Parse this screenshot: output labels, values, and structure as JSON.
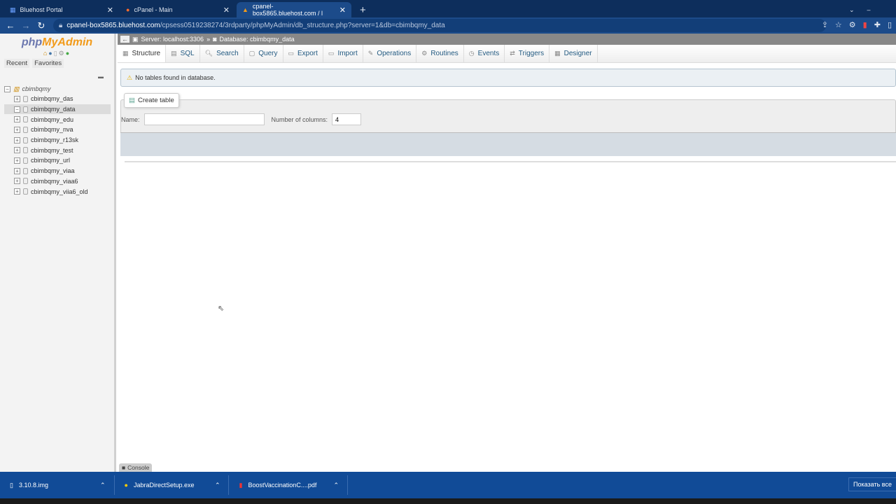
{
  "browser": {
    "tabs": [
      {
        "label": "Bluehost Portal",
        "icon": "grid-icon"
      },
      {
        "label": "cPanel - Main",
        "icon": "cpanel-icon"
      },
      {
        "label": "cpanel-box5865.bluehost.com / l",
        "icon": "phpmyadmin-icon",
        "active": true
      }
    ],
    "url_host": "cpanel-box5865.bluehost.com",
    "url_path": "/cpsess0519238274/3rdparty/phpMyAdmin/db_structure.php?server=1&db=cbimbqmy_data"
  },
  "sidebar": {
    "logo_php": "php",
    "logo_myadmin": "MyAdmin",
    "recent": "Recent",
    "favorites": "Favorites",
    "root": "cbimbqmy",
    "databases": [
      "cbimbqmy_das",
      "cbimbqmy_data",
      "cbimbqmy_edu",
      "cbimbqmy_nva",
      "cbimbqmy_r13sk",
      "cbimbqmy_test",
      "cbimbqmy_url",
      "cbimbqmy_viaa",
      "cbimbqmy_viaa6",
      "cbimbqmy_viia6_old"
    ],
    "selected": "cbimbqmy_data"
  },
  "breadcrumb": {
    "server": "Server: localhost:3306",
    "sep": "»",
    "database": "Database: cbimbqmy_data"
  },
  "menu": [
    "Structure",
    "SQL",
    "Search",
    "Query",
    "Export",
    "Import",
    "Operations",
    "Routines",
    "Events",
    "Triggers",
    "Designer"
  ],
  "notice": "No tables found in database.",
  "create": {
    "legend": "Create table",
    "name_label": "Name:",
    "name_value": "",
    "cols_label": "Number of columns:",
    "cols_value": "4"
  },
  "console": "Console",
  "downloads": [
    {
      "name": "3.10.8.img"
    },
    {
      "name": "JabraDirectSetup.exe"
    },
    {
      "name": "BoostVaccinationC....pdf"
    }
  ],
  "show_all": "Показать все"
}
